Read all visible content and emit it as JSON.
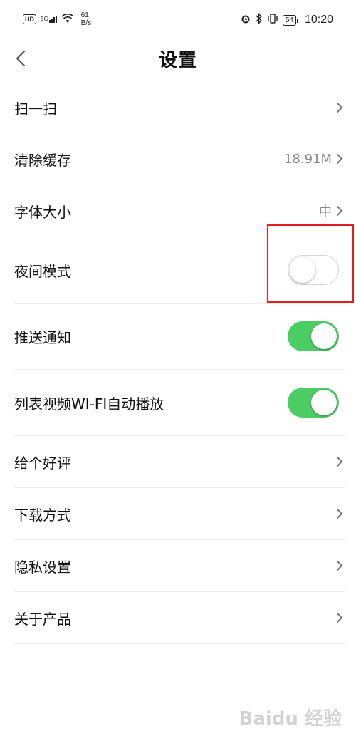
{
  "status_bar": {
    "hd": "HD",
    "signal_type": "5G",
    "net_speed_value": "61",
    "net_speed_unit": "B/s",
    "battery": "54",
    "time": "10:20"
  },
  "header": {
    "title": "设置"
  },
  "settings": {
    "items": [
      {
        "label": "扫一扫",
        "value": "",
        "control": "chevron"
      },
      {
        "label": "清除缓存",
        "value": "18.91M",
        "control": "chevron"
      },
      {
        "label": "字体大小",
        "value": "中",
        "control": "chevron"
      },
      {
        "label": "夜间模式",
        "control": "toggle",
        "on": false
      },
      {
        "label": "推送通知",
        "control": "toggle",
        "on": true
      },
      {
        "label": "列表视频WI-FI自动播放",
        "control": "toggle",
        "on": true
      },
      {
        "label": "给个好评",
        "value": "",
        "control": "chevron"
      },
      {
        "label": "下载方式",
        "value": "",
        "control": "chevron"
      },
      {
        "label": "隐私设置",
        "value": "",
        "control": "chevron"
      },
      {
        "label": "关于产品",
        "value": "",
        "control": "chevron"
      }
    ]
  },
  "colors": {
    "toggle_on": "#4ccd64",
    "highlight": "#e02020"
  },
  "watermark": "Baidu 经验"
}
